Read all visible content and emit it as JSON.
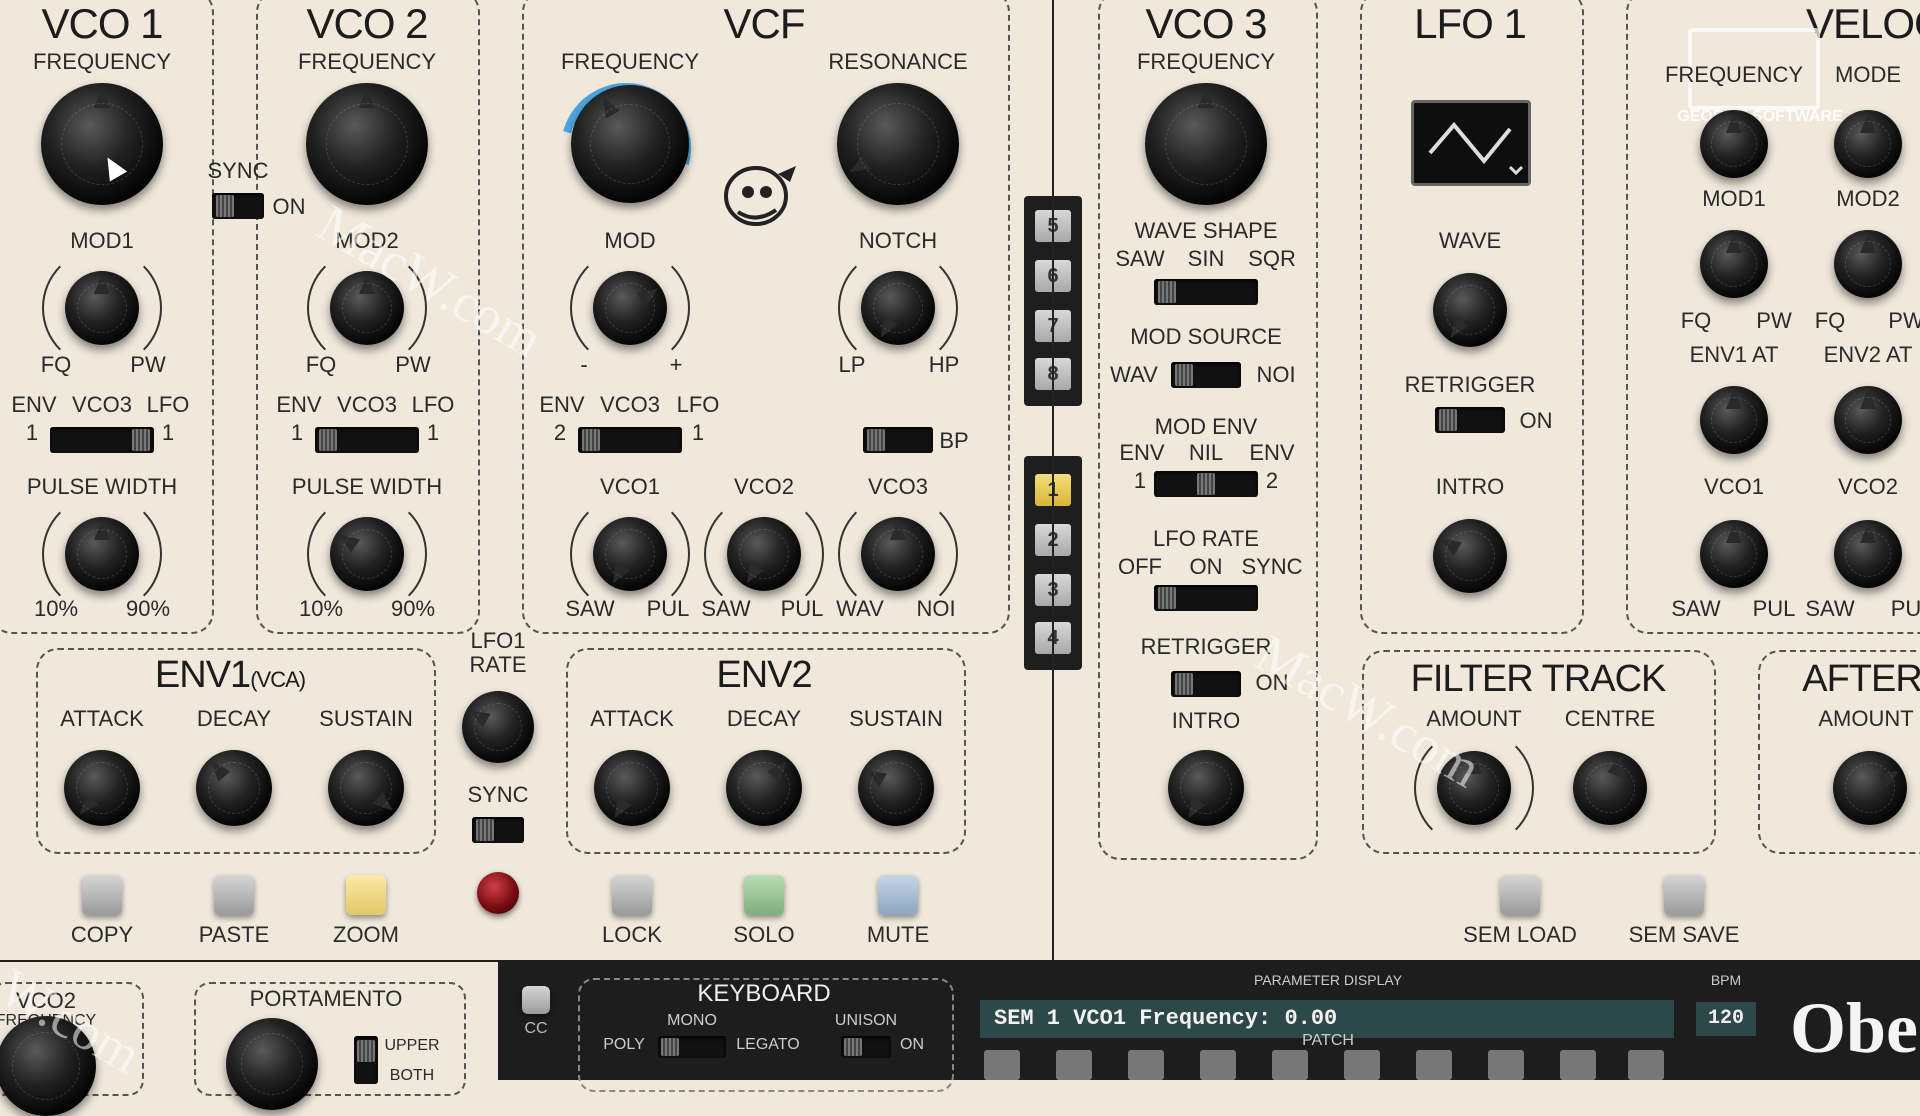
{
  "colors": {
    "panel": "#efe8db",
    "sync_active": "#4aa8e0",
    "zoom_button": "#f2dd8a",
    "solo_button": "#9ccb9a",
    "mute_button": "#a9bfd6",
    "selected_patch": "#f0d35a",
    "led": "#7a0d12"
  },
  "vco1": {
    "title": "VCO 1",
    "frequency": "FREQUENCY",
    "mod": "MOD1",
    "fq": "FQ",
    "pw": "PW",
    "env": "ENV",
    "vco3": "VCO3",
    "lfo": "LFO",
    "one_left": "1",
    "one_right": "1",
    "pulse_width": "PULSE WIDTH",
    "min": "10%",
    "max": "90%"
  },
  "vco2": {
    "title": "VCO 2",
    "frequency": "FREQUENCY",
    "mod": "MOD2",
    "fq": "FQ",
    "pw": "PW",
    "env": "ENV",
    "vco3": "VCO3",
    "lfo": "LFO",
    "one_left": "1",
    "one_right": "1",
    "pulse_width": "PULSE WIDTH",
    "min": "10%",
    "max": "90%",
    "sync": "SYNC",
    "sync_on": "ON"
  },
  "vcf": {
    "title": "VCF",
    "frequency": "FREQUENCY",
    "resonance": "RESONANCE",
    "mod": "MOD",
    "minus": "-",
    "plus": "+",
    "notch": "NOTCH",
    "lp": "LP",
    "hp": "HP",
    "env": "ENV",
    "vco3": "VCO3",
    "lfo": "LFO",
    "two": "2",
    "one": "1",
    "bp": "BP",
    "vco1": "VCO1",
    "vco2": "VCO2",
    "vco3_knob": "VCO3",
    "saw": "SAW",
    "pul": "PUL",
    "saw2": "SAW",
    "pul2": "PUL",
    "wav": "WAV",
    "noi": "NOI"
  },
  "patch_strip": {
    "upper": [
      "5",
      "6",
      "7",
      "8"
    ],
    "lower": [
      "1",
      "2",
      "3",
      "4"
    ],
    "selected": "1"
  },
  "vco3": {
    "title": "VCO 3",
    "frequency": "FREQUENCY",
    "wave_shape": "WAVE SHAPE",
    "saw": "SAW",
    "sin": "SIN",
    "sqr": "SQR",
    "mod_source": "MOD SOURCE",
    "wav": "WAV",
    "noi": "NOI",
    "mod_env": "MOD ENV",
    "env_l": "ENV",
    "nil": "NIL",
    "env_r": "ENV",
    "one": "1",
    "two": "2",
    "lfo_rate": "LFO RATE",
    "off": "OFF",
    "on": "ON",
    "sync": "SYNC",
    "retrigger": "RETRIGGER",
    "retrigger_on": "ON",
    "intro": "INTRO"
  },
  "lfo1": {
    "title": "LFO 1",
    "wave": "WAVE",
    "retrigger": "RETRIGGER",
    "retrigger_on": "ON",
    "intro": "INTRO"
  },
  "velocity": {
    "title": "VELOCI",
    "frequency": "FREQUENCY",
    "mode": "MODE",
    "mod1": "MOD1",
    "mod2": "MOD2",
    "fq1": "FQ",
    "pw1": "PW",
    "fq2": "FQ",
    "pw2": "PW",
    "env1at": "ENV1 AT",
    "env2at": "ENV2 AT",
    "vco1": "VCO1",
    "vco2": "VCO2",
    "saw1": "SAW",
    "pul1": "PUL",
    "saw2": "SAW",
    "pul2": "PU"
  },
  "logo": {
    "text": "GEORGE SOFTWARE"
  },
  "env1": {
    "title": "ENV1",
    "sub": "(VCA)",
    "attack": "ATTACK",
    "decay": "DECAY",
    "sustain": "SUSTAIN"
  },
  "lfo_rate": {
    "l1": "LFO1",
    "l2": "RATE",
    "sync": "SYNC"
  },
  "env2": {
    "title": "ENV2",
    "attack": "ATTACK",
    "decay": "DECAY",
    "sustain": "SUSTAIN"
  },
  "filter_track": {
    "title": "FILTER TRACK",
    "amount": "AMOUNT",
    "centre": "CENTRE"
  },
  "after": {
    "title": "AFTER",
    "amount": "AMOUNT"
  },
  "buttons": {
    "copy": "COPY",
    "paste": "PASTE",
    "zoom": "ZOOM",
    "lock": "LOCK",
    "solo": "SOLO",
    "mute": "MUTE",
    "sem_load": "SEM LOAD",
    "sem_save": "SEM SAVE"
  },
  "bottom": {
    "vco2": "VCO2",
    "vco2_freq": "FREQUENCY",
    "portamento": "PORTAMENTO",
    "upper": "UPPER",
    "both": "BOTH",
    "cc": "CC",
    "keyboard": "KEYBOARD",
    "mono": "MONO",
    "poly": "POLY",
    "legato": "LEGATO",
    "unison": "UNISON",
    "unison_on": "ON",
    "param_display": "PARAMETER DISPLAY",
    "param_value": "SEM 1 VCO1 Frequency: 0.00",
    "patch": "PATCH",
    "bpm_label": "BPM",
    "bpm_value": "120",
    "brand": "Obe"
  },
  "watermarks": [
    "MacW.com",
    "MacW.com",
    "W.com"
  ]
}
